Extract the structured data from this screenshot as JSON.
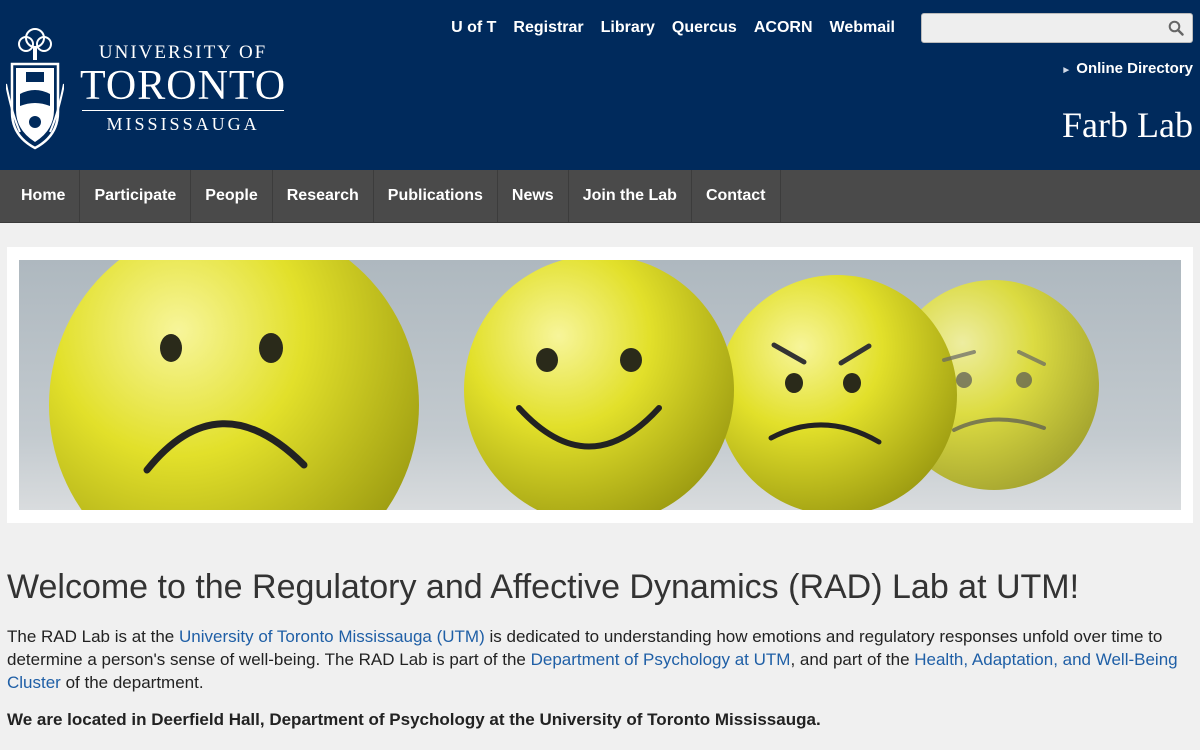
{
  "header": {
    "logo": {
      "line1": "UNIVERSITY OF",
      "line2": "TORONTO",
      "line3": "MISSISSAUGA"
    },
    "top_links": [
      "U of T",
      "Registrar",
      "Library",
      "Quercus",
      "ACORN",
      "Webmail"
    ],
    "search": {
      "placeholder": "",
      "value": ""
    },
    "online_directory": "Online Directory",
    "site_name": "Farb Lab"
  },
  "nav": {
    "items": [
      "Home",
      "Participate",
      "People",
      "Research",
      "Publications",
      "News",
      "Join the Lab",
      "Contact"
    ]
  },
  "banner": {
    "image": "emoji-balls-banner",
    "colors": {
      "ball": "#e3e22c",
      "background": "#b9c1c7"
    }
  },
  "content": {
    "heading": "Welcome to the Regulatory and Affective Dynamics (RAD) Lab at UTM!",
    "p1": {
      "t1": "The RAD Lab is at the ",
      "link1": "University of Toronto Mississauga (UTM)",
      "t2": " is dedicated to understanding how emotions and regulatory responses unfold over time to determine a person's sense of well-being. The RAD Lab is part of the ",
      "link2": "Department of Psychology at UTM",
      "t3": ", and part of the ",
      "link3": "Health, Adaptation, and Well-Being Cluster",
      "t4": " of the department."
    },
    "p2": "We are located in Deerfield Hall, Department of Psychology at the University of Toronto Mississauga."
  },
  "colors": {
    "header_bg": "#002a5c",
    "nav_bg": "#4a4a4a",
    "link": "#1f5fa6"
  }
}
